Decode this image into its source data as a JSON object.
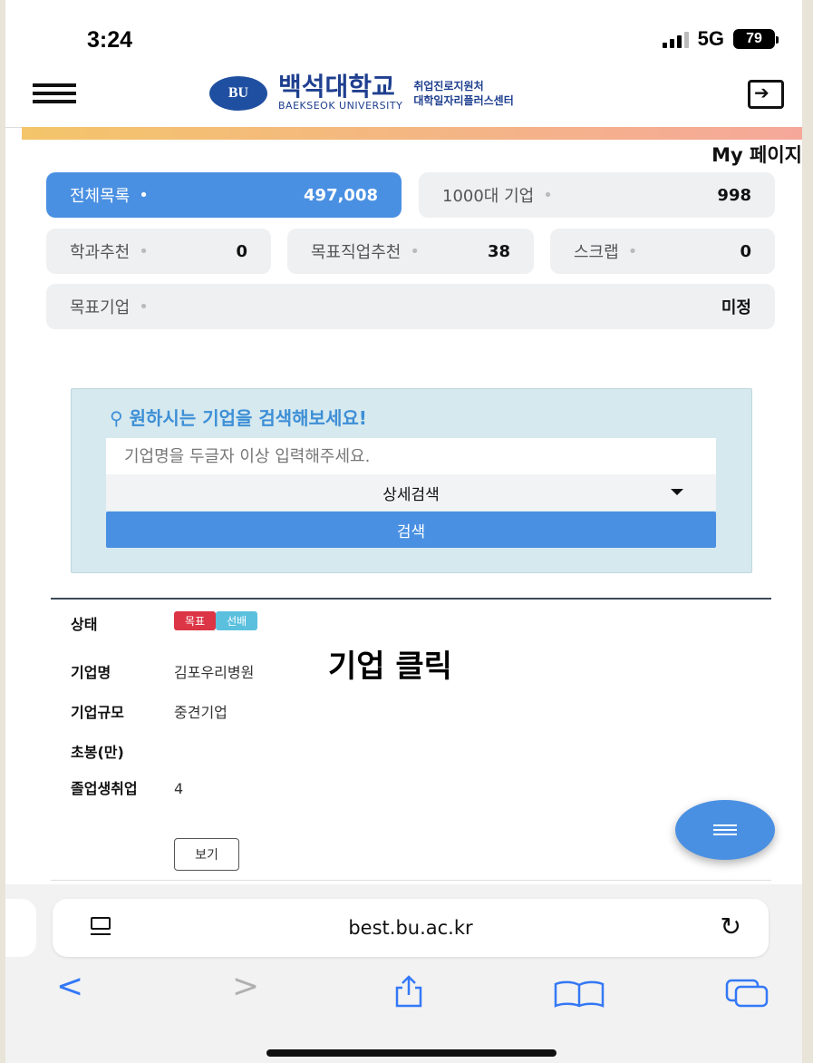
{
  "status": {
    "time": "3:24",
    "network": "5G",
    "battery": "79"
  },
  "header": {
    "logo_mark": "BU",
    "logo_ko": "백석대학교",
    "logo_en": "BAEKSEOK UNIVERSITY",
    "sub_line1": "취업진로지원처",
    "sub_line2": "대학일자리플러스센터"
  },
  "mypage_label": "My 페이지",
  "stats": {
    "all": {
      "label": "전체목록",
      "value": "497,008"
    },
    "top1000": {
      "label": "1000대 기업",
      "value": "998"
    },
    "major": {
      "label": "학과추천",
      "value": "0"
    },
    "job": {
      "label": "목표직업추천",
      "value": "38"
    },
    "scrap": {
      "label": "스크랩",
      "value": "0"
    },
    "target": {
      "label": "목표기업",
      "value": "미정"
    }
  },
  "search": {
    "title": "원하시는 기업을 검색해보세요!",
    "placeholder": "기업명을 두글자 이상 입력해주세요.",
    "detail_label": "상세검색",
    "button_label": "검색"
  },
  "result": {
    "status_label": "상태",
    "tag_goal": "목표",
    "tag_senior": "선배",
    "company_label": "기업명",
    "company_value": "김포우리병원",
    "size_label": "기업규모",
    "size_value": "중견기업",
    "salary_label": "초봉(만)",
    "salary_value": "",
    "grad_label": "졸업생취업",
    "grad_value": "4",
    "view_label": "보기"
  },
  "annotation": "기업 클릭",
  "safari": {
    "url": "best.bu.ac.kr"
  },
  "colors": {
    "accent": "#4a90e2",
    "tag_red": "#dc3545",
    "tag_teal": "#5bc0de",
    "brand": "#1f3f8f"
  }
}
